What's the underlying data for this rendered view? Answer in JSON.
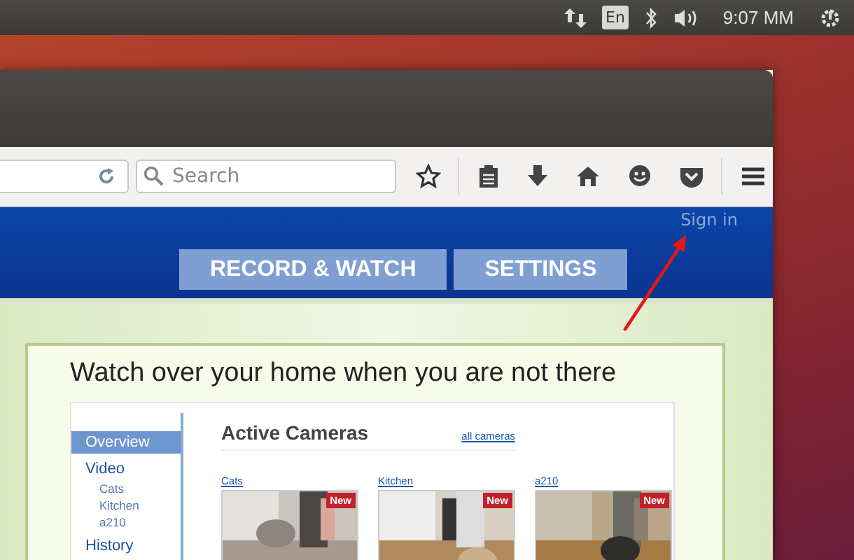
{
  "top_panel": {
    "keyboard_layout": "En",
    "clock": "9:07 MM"
  },
  "toolbar": {
    "search": {
      "placeholder": "Search"
    }
  },
  "page": {
    "sign_in": "Sign in",
    "nav_tabs": [
      {
        "label": "RECORD & WATCH"
      },
      {
        "label": "SETTINGS"
      }
    ],
    "headline": "Watch over your home when you are not there",
    "preview": {
      "sidebar": [
        {
          "label": "Overview",
          "selected": true
        },
        {
          "label": "Video",
          "selected": false,
          "children": [
            {
              "label": "Cats"
            },
            {
              "label": "Kitchen"
            },
            {
              "label": "a210"
            }
          ]
        },
        {
          "label": "History",
          "selected": false
        }
      ],
      "title": "Active Cameras",
      "all_link": "all cameras",
      "cameras": [
        {
          "name": "Cats",
          "badge": "New",
          "kind": "picture"
        },
        {
          "name": "Kitchen",
          "badge": "New",
          "kind": "picture"
        },
        {
          "name": "a210",
          "badge": "New",
          "kind": "picture"
        }
      ]
    }
  }
}
